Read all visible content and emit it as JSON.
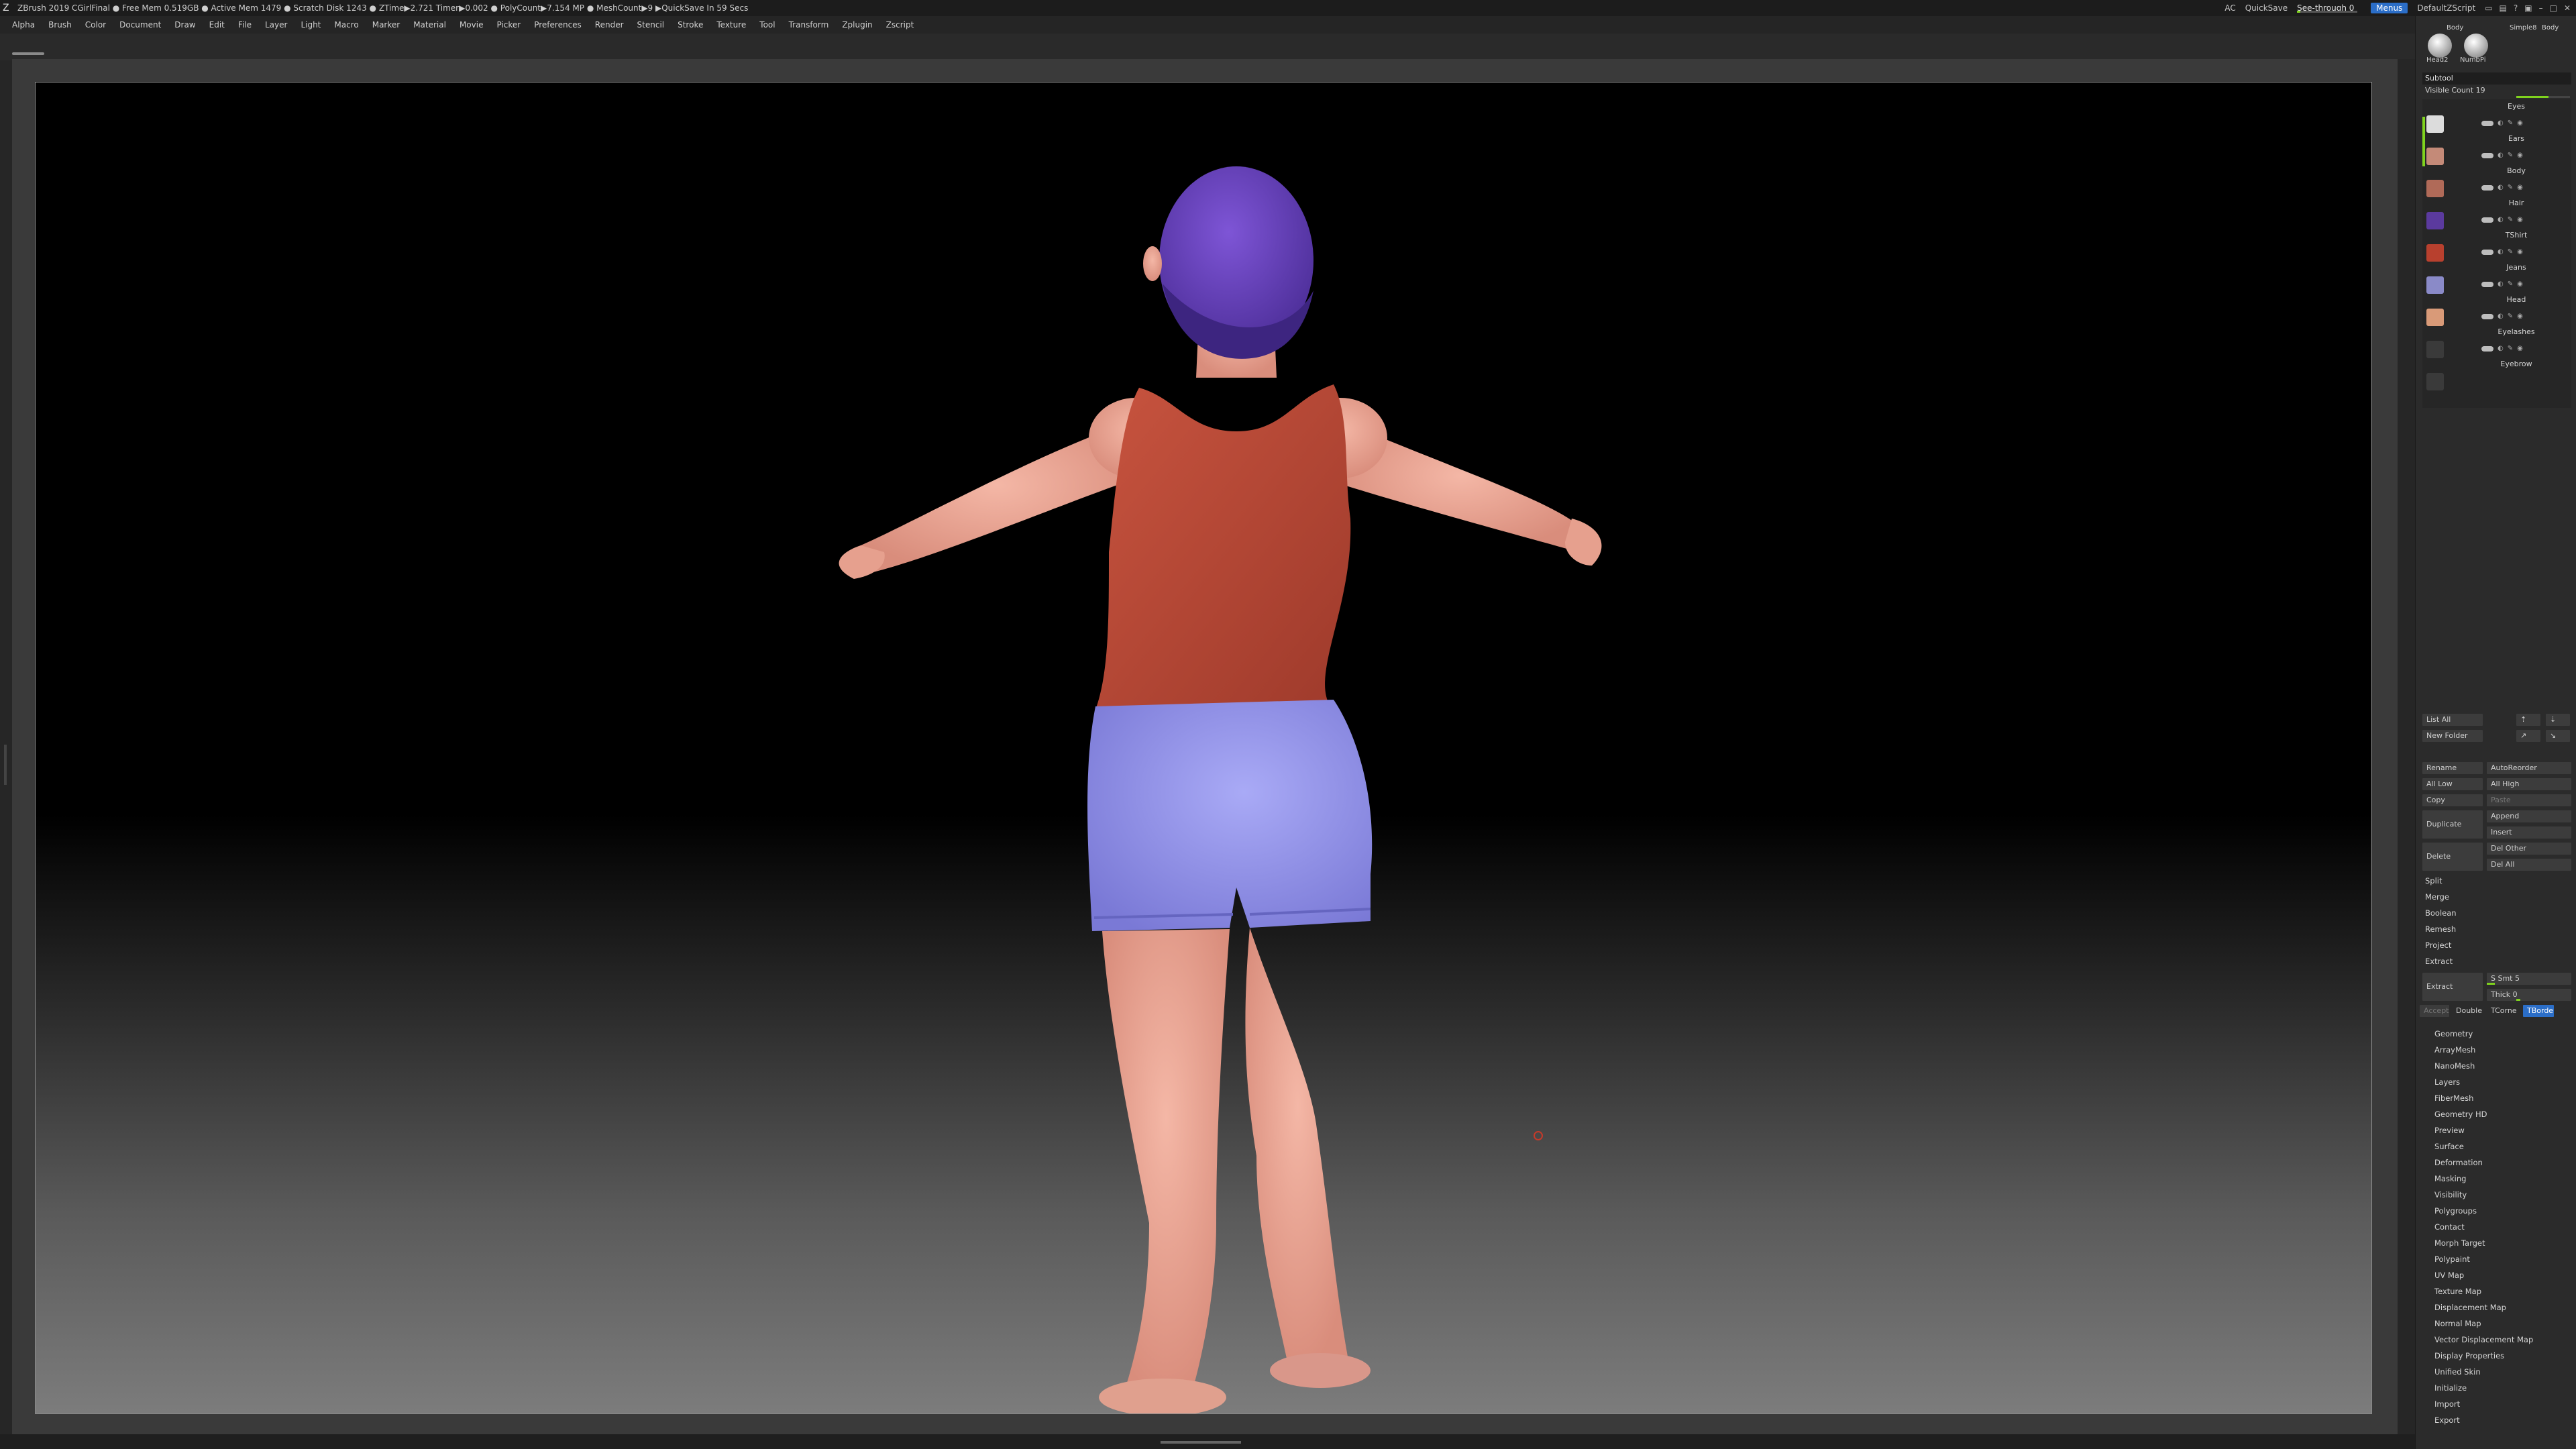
{
  "titlebar": {
    "status": "ZBrush 2019   CGirlFinal   ● Free Mem 0.519GB ● Active Mem 1479 ● Scratch Disk 1243 ● ZTime▶2.721 Timer▶0.002 ● PolyCount▶7.154 MP ● MeshCount▶9 ▶QuickSave In 59 Secs",
    "ac": "AC",
    "quicksave": "QuickSave",
    "see_through_label": "See-through 0",
    "see_through_value": 0.05,
    "menu_label": "Menus",
    "default_script": "DefaultZScript",
    "accent": "#7fd21e"
  },
  "menubar": [
    "Alpha",
    "Brush",
    "Color",
    "Document",
    "Draw",
    "Edit",
    "File",
    "Layer",
    "Light",
    "Macro",
    "Marker",
    "Material",
    "Movie",
    "Picker",
    "Preferences",
    "Render",
    "Stencil",
    "Stroke",
    "Texture",
    "Tool",
    "Transform",
    "Zplugin",
    "Zscript"
  ],
  "tray": {
    "thumb_labels": [
      "Body",
      "Simple8",
      "Body",
      "Head2",
      "NumbPi"
    ],
    "subtool_title": "Subtool",
    "visible_count": "Visible Count 19",
    "visible_fraction": 0.6,
    "subtools": [
      "Eyes",
      "Ears",
      "Body",
      "Hair",
      "TShirt",
      "Jeans",
      "Head",
      "Eyelashes",
      "Eyebrow"
    ],
    "list_all": "List All",
    "new_folder": "New Folder",
    "rename": "Rename",
    "auto_reorder": "AutoReorder",
    "all_low": "All Low",
    "all_high": "All High",
    "copy": "Copy",
    "paste": "Paste",
    "duplicate": "Duplicate",
    "append": "Append",
    "insert": "Insert",
    "delete": "Delete",
    "del_other": "Del Other",
    "del_all": "Del All",
    "split": "Split",
    "merge": "Merge",
    "boolean": "Boolean",
    "remesh": "Remesh",
    "project": "Project",
    "extract_section": "Extract",
    "extract_btn": "Extract",
    "s_smt": "S Smt 5",
    "thick": "Thick 0",
    "accept": "Accept",
    "double": "Double",
    "tcorne": "TCorne",
    "tborder": "TBorde",
    "sections": [
      "Geometry",
      "ArrayMesh",
      "NanoMesh",
      "Layers",
      "FiberMesh",
      "Geometry HD",
      "Preview",
      "Surface",
      "Deformation",
      "Masking",
      "Visibility",
      "Polygroups",
      "Contact",
      "Morph Target",
      "Polypaint",
      "UV Map",
      "Texture Map",
      "Displacement Map",
      "Normal Map",
      "Vector Displacement Map",
      "Display Properties",
      "Unified Skin",
      "Initialize",
      "Import",
      "Export"
    ]
  }
}
